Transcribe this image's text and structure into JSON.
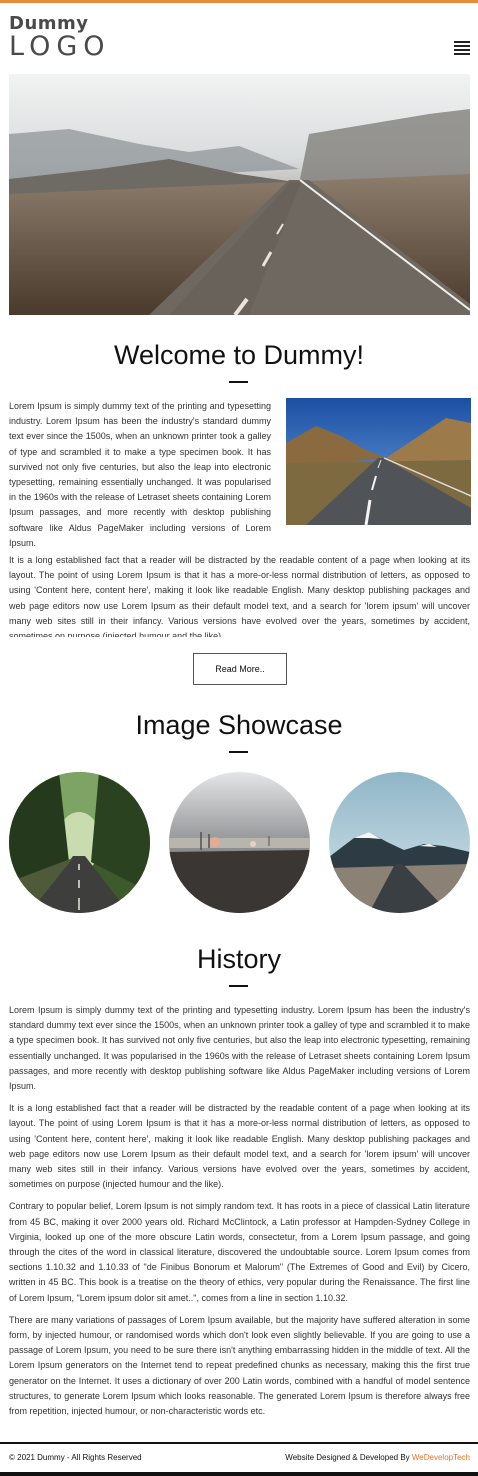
{
  "header": {
    "logo_small": "Dummy",
    "logo_big": "LOGO",
    "menu_icon": "hamburger-menu-icon"
  },
  "hero": {
    "image": "mountain-road-photo"
  },
  "welcome": {
    "title": "Welcome to Dummy!",
    "paragraph1": "Lorem Ipsum is simply dummy text of the printing and typesetting industry. Lorem Ipsum has been the industry's standard dummy text ever since the 1500s, when an unknown printer took a galley of type and scrambled it to make a type specimen book. It has survived not only five centuries, but also the leap into electronic typesetting, remaining essentially unchanged. It was popularised in the 1960s with the release of Letraset sheets containing Lorem Ipsum passages, and more recently with desktop publishing software like Aldus PageMaker including versions of Lorem Ipsum.",
    "paragraph2": "It is a long established fact that a reader will be distracted by the readable content of a page when looking at its layout. The point of using Lorem Ipsum is that it has a more-or-less normal distribution of letters, as opposed to using 'Content here, content here', making it look like readable English. Many desktop publishing packages and web page editors now use Lorem Ipsum as their default model text, and a search for 'lorem ipsum' will uncover many web sites still in their infancy. Various versions have evolved over the years, sometimes by accident, sometimes on purpose (injected humour and the like).",
    "read_more": "Read More.."
  },
  "showcase": {
    "title": "Image Showcase",
    "images": [
      "forest-road-photo",
      "foggy-field-photo",
      "snowy-mountain-road-photo"
    ]
  },
  "history": {
    "title": "History",
    "paragraphs": [
      "Lorem Ipsum is simply dummy text of the printing and typesetting industry. Lorem Ipsum has been the industry's standard dummy text ever since the 1500s, when an unknown printer took a galley of type and scrambled it to make a type specimen book. It has survived not only five centuries, but also the leap into electronic typesetting, remaining essentially unchanged. It was popularised in the 1960s with the release of Letraset sheets containing Lorem Ipsum passages, and more recently with desktop publishing software like Aldus PageMaker including versions of Lorem Ipsum.",
      "It is a long established fact that a reader will be distracted by the readable content of a page when looking at its layout. The point of using Lorem Ipsum is that it has a more-or-less normal distribution of letters, as opposed to using 'Content here, content here', making it look like readable English. Many desktop publishing packages and web page editors now use Lorem Ipsum as their default model text, and a search for 'lorem ipsum' will uncover many web sites still in their infancy. Various versions have evolved over the years, sometimes by accident, sometimes on purpose (injected humour and the like).",
      "Contrary to popular belief, Lorem Ipsum is not simply random text. It has roots in a piece of classical Latin literature from 45 BC, making it over 2000 years old. Richard McClintock, a Latin professor at Hampden-Sydney College in Virginia, looked up one of the more obscure Latin words, consectetur, from a Lorem Ipsum passage, and going through the cites of the word in classical literature, discovered the undoubtable source. Lorem Ipsum comes from sections 1.10.32 and 1.10.33 of \"de Finibus Bonorum et Malorum\" (The Extremes of Good and Evil) by Cicero, written in 45 BC. This book is a treatise on the theory of ethics, very popular during the Renaissance. The first line of Lorem Ipsum, \"Lorem ipsum dolor sit amet..\", comes from a line in section 1.10.32.",
      "There are many variations of passages of Lorem Ipsum available, but the majority have suffered alteration in some form, by injected humour, or randomised words which don't look even slightly believable. If you are going to use a passage of Lorem Ipsum, you need to be sure there isn't anything embarrassing hidden in the middle of text. All the Lorem Ipsum generators on the Internet tend to repeat predefined chunks as necessary, making this the first true generator on the Internet. It uses a dictionary of over 200 Latin words, combined with a handful of model sentence structures, to generate Lorem Ipsum which looks reasonable. The generated Lorem Ipsum is therefore always free from repetition, injected humour, or non-characteristic words etc."
    ]
  },
  "footer": {
    "copyright": "© 2021 Dummy - All Rights Reserved",
    "credit_prefix": "Website Designed & Developed By ",
    "credit_brand": "WeDevelopTech"
  },
  "colors": {
    "accent": "#e88a3c",
    "brand_link": "#e8742a",
    "text": "#333333"
  }
}
